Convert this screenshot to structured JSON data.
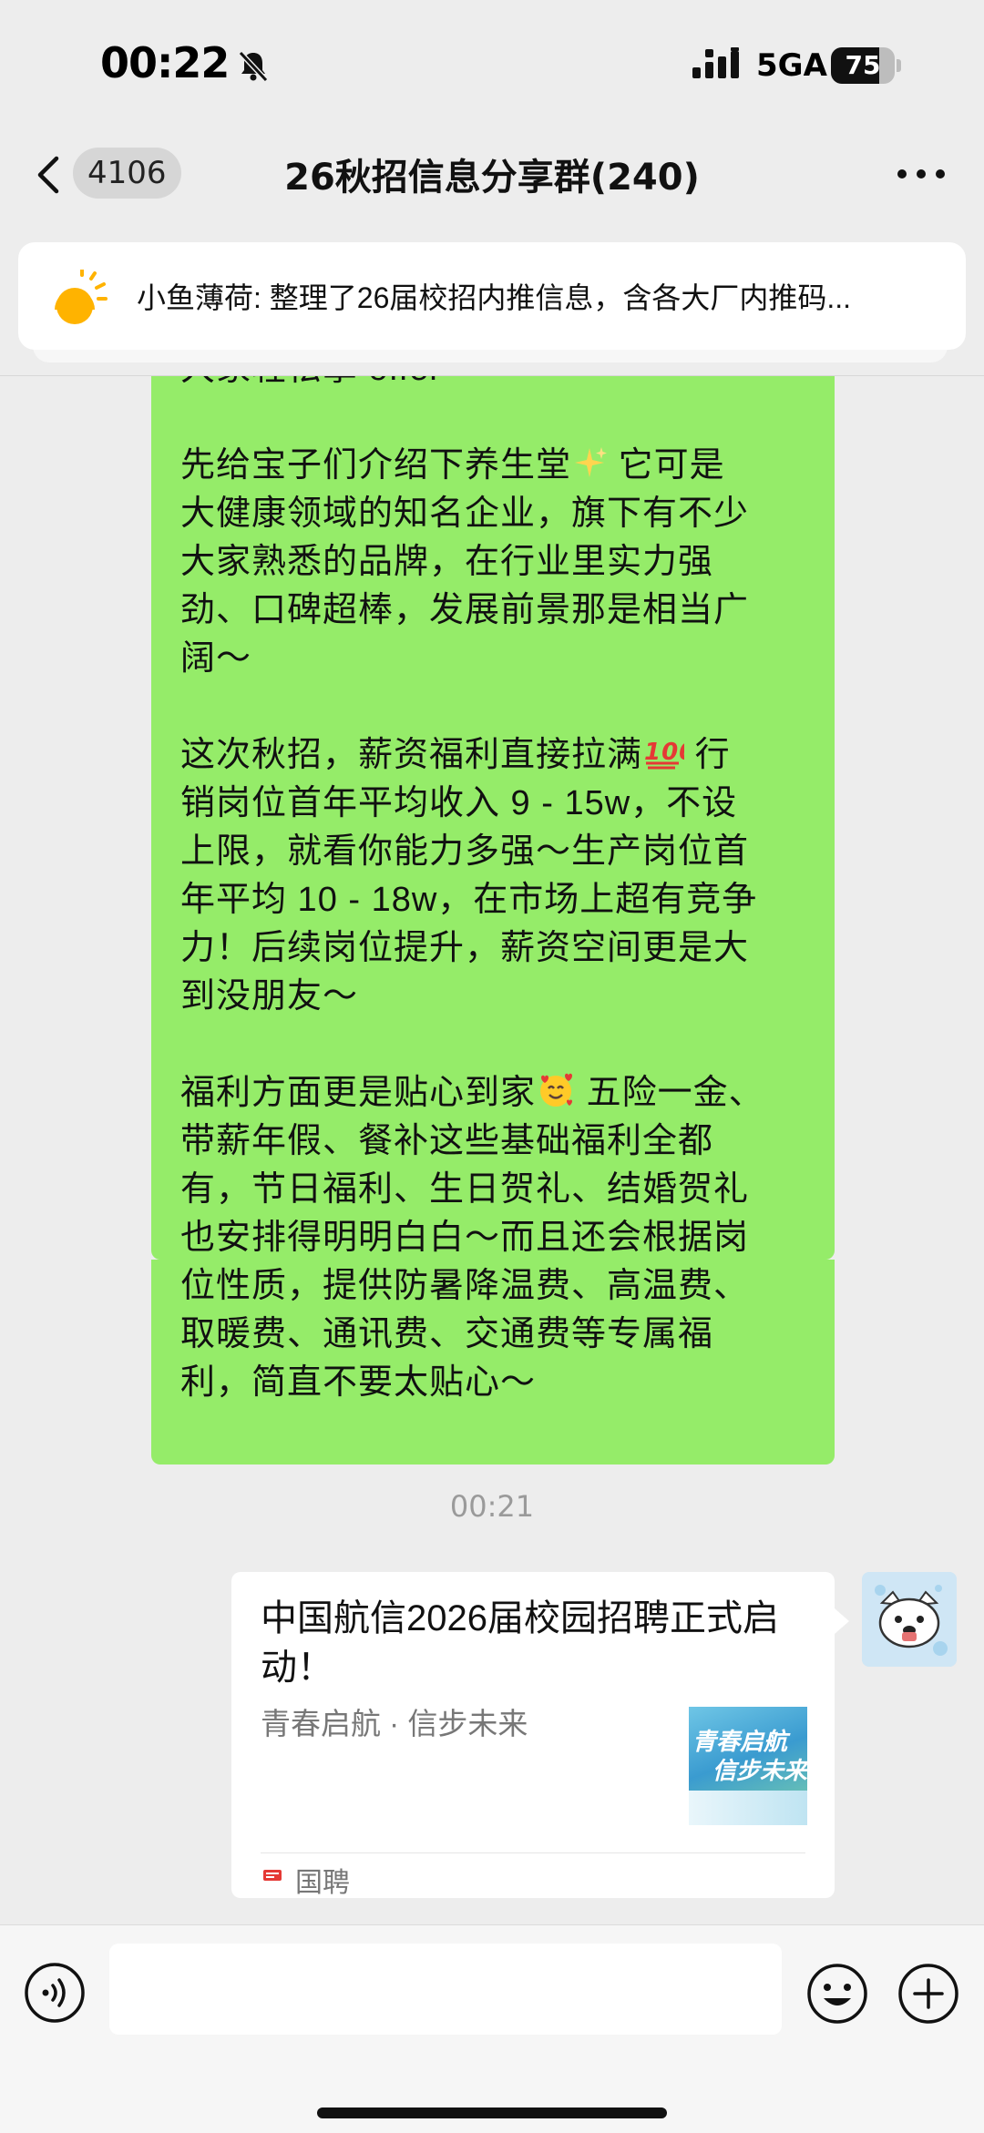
{
  "status_bar": {
    "time": "00:22",
    "network": "5GA",
    "battery": "75",
    "battery_level": 0.75,
    "icons": [
      "mute-bell-icon",
      "signal-icon",
      "battery-icon"
    ]
  },
  "nav": {
    "unread_count": "4106",
    "title": "26秋招信息分享群(240)",
    "icons": [
      "back-chevron-icon",
      "more-dots-icon"
    ]
  },
  "pinned": {
    "text": "小鱼薄荷: 整理了26届校招内推信息，含各大厂内推码...",
    "icon": "sun-icon"
  },
  "message": {
    "lines": [
      "大家轻松拿 offer～",
      "",
      "先给宝子们介绍下养生堂",
      "大健康领域的知名企业，旗下有不少",
      "大家熟悉的品牌，在行业里实力强",
      "劲、口碑超棒，发展前景那是相当广",
      "阔～",
      "",
      "这次秋招，薪资福利直接拉满",
      "销岗位首年平均收入 9 - 15w，不设",
      "上限，就看你能力多强～生产岗位首",
      "年平均 10 - 18w，在市场上超有竞争",
      "力！后续岗位提升，薪资空间更是大",
      "到没朋友～",
      "",
      "福利方面更是贴心到家",
      "带薪年假、餐补这些基础福利全都",
      "有，节日福利、生日贺礼、结婚贺礼",
      "也安排得明明白白～而且还会根据岗",
      "位性质，提供防暑降温费、高温费、",
      "取暖费、通讯费、交通费等专属福",
      "利，简直不要太贴心～"
    ],
    "line_tails": {
      "l2": "它可是",
      "l8": "行",
      "l15": "五险一金、"
    },
    "emojis": [
      "sparkles-emoji",
      "hundred-points-emoji",
      "smiling-face-with-hearts-emoji"
    ]
  },
  "timestamp": "00:21",
  "link_card": {
    "title": "中国航信2026届校园招聘正式启动！",
    "subtitle": "青春启航 · 信步未来",
    "thumb_line1": "青春启航",
    "thumb_line2": "信步未来",
    "source": "国聘"
  },
  "input": {
    "placeholder": "",
    "icons": [
      "voice-icon",
      "emoji-face-icon",
      "plus-icon"
    ]
  }
}
